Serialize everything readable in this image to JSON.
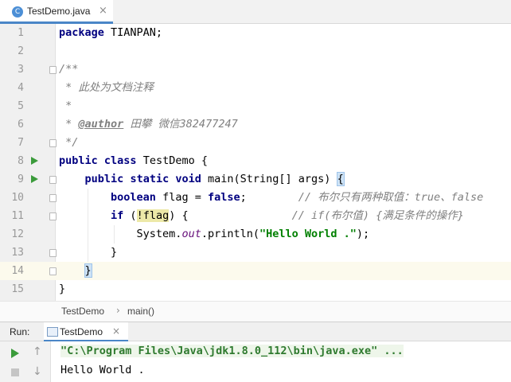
{
  "editor_tab": {
    "icon_letter": "C",
    "file_name": "TestDemo.java",
    "close_glyph": "×"
  },
  "code_lines": [
    {
      "num": "1",
      "parts": [
        {
          "t": "package",
          "c": "kw"
        },
        {
          "t": " TIANPAN;",
          "c": ""
        }
      ]
    },
    {
      "num": "2",
      "parts": []
    },
    {
      "num": "3",
      "parts": [
        {
          "t": "/**",
          "c": "cm"
        }
      ]
    },
    {
      "num": "4",
      "parts": [
        {
          "t": " * 此处为文档注释",
          "c": "cm"
        }
      ]
    },
    {
      "num": "5",
      "parts": [
        {
          "t": " *",
          "c": "cm"
        }
      ]
    },
    {
      "num": "6",
      "parts": [
        {
          "t": " * ",
          "c": "cm"
        },
        {
          "t": "@author",
          "c": "tag"
        },
        {
          "t": " 田攀 微信382477247",
          "c": "cm"
        }
      ]
    },
    {
      "num": "7",
      "parts": [
        {
          "t": " */",
          "c": "cm"
        }
      ]
    },
    {
      "num": "8",
      "parts": [
        {
          "t": "public",
          "c": "kw"
        },
        {
          "t": " ",
          "c": ""
        },
        {
          "t": "class",
          "c": "kw"
        },
        {
          "t": " TestDemo {",
          "c": ""
        }
      ]
    },
    {
      "num": "9",
      "parts": [
        {
          "t": "    ",
          "c": ""
        },
        {
          "t": "public",
          "c": "kw"
        },
        {
          "t": " ",
          "c": ""
        },
        {
          "t": "static",
          "c": "kw"
        },
        {
          "t": " ",
          "c": ""
        },
        {
          "t": "void",
          "c": "kw"
        },
        {
          "t": " main(String[] args) ",
          "c": ""
        },
        {
          "t": "{",
          "c": "brace-hl"
        }
      ]
    },
    {
      "num": "10",
      "parts": [
        {
          "t": "        ",
          "c": ""
        },
        {
          "t": "boolean",
          "c": "kw"
        },
        {
          "t": " flag = ",
          "c": ""
        },
        {
          "t": "false",
          "c": "kw"
        },
        {
          "t": ";        ",
          "c": ""
        },
        {
          "t": "// 布尔只有两种取值：true、false",
          "c": "cm"
        }
      ]
    },
    {
      "num": "11",
      "parts": [
        {
          "t": "        ",
          "c": ""
        },
        {
          "t": "if",
          "c": "kw"
        },
        {
          "t": " (",
          "c": ""
        },
        {
          "t": "!flag",
          "c": "paren-hl"
        },
        {
          "t": ") {                ",
          "c": ""
        },
        {
          "t": "// if(布尔值) {满足条件的操作}",
          "c": "cm"
        }
      ]
    },
    {
      "num": "12",
      "parts": [
        {
          "t": "            System.",
          "c": ""
        },
        {
          "t": "out",
          "c": "fld"
        },
        {
          "t": ".println(",
          "c": ""
        },
        {
          "t": "\"Hello World .\"",
          "c": "str"
        },
        {
          "t": ");",
          "c": ""
        }
      ]
    },
    {
      "num": "13",
      "parts": [
        {
          "t": "        }",
          "c": ""
        }
      ]
    },
    {
      "num": "14",
      "parts": [
        {
          "t": "    ",
          "c": ""
        },
        {
          "t": "}",
          "c": "brace-hl"
        }
      ]
    },
    {
      "num": "15",
      "parts": [
        {
          "t": "}",
          "c": ""
        }
      ]
    }
  ],
  "current_line": "14",
  "run_gutter_lines": [
    "8",
    "9"
  ],
  "fold_lines": [
    "3",
    "7",
    "9",
    "10",
    "11",
    "13",
    "14"
  ],
  "breadcrumb": {
    "items": [
      "TestDemo",
      "main()"
    ],
    "separator": "›"
  },
  "run_panel": {
    "label": "Run:",
    "tab_label": "TestDemo",
    "close_glyph": "×",
    "console_lines": [
      "\"C:\\Program Files\\Java\\jdk1.8.0_112\\bin\\java.exe\" ...",
      "Hello World ."
    ]
  },
  "colors": {
    "keyword": "#000080",
    "comment": "#808080",
    "string": "#008000",
    "field": "#660e7a",
    "run": "#3b9b3b",
    "accent": "#4a86c7"
  }
}
